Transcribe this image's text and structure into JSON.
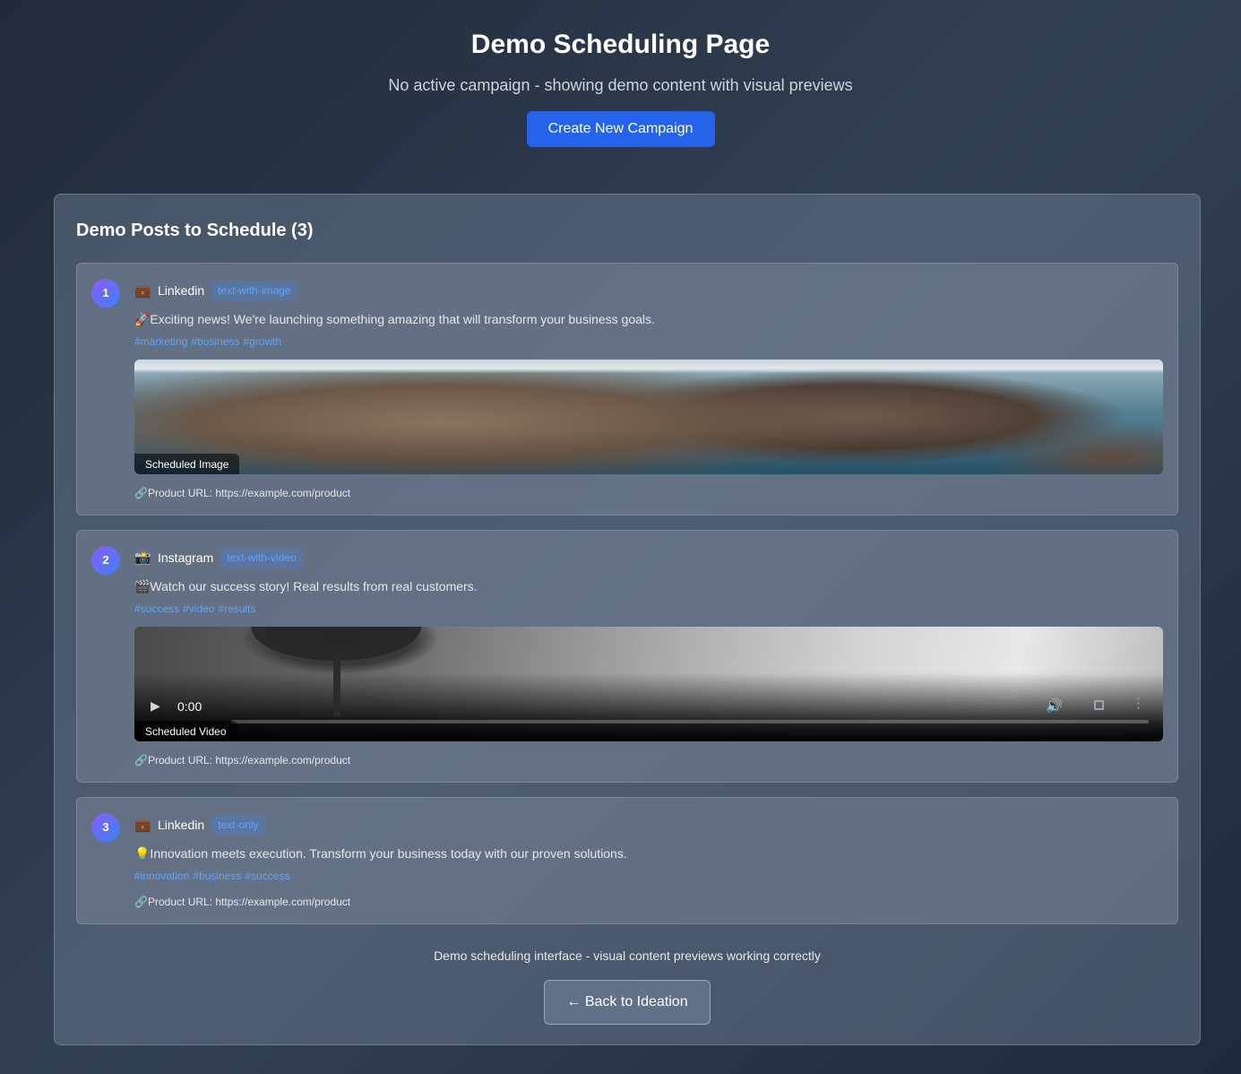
{
  "header": {
    "title": "Demo Scheduling Page",
    "subtitle": "No active campaign - showing demo content with visual previews",
    "create_button": "Create New Campaign"
  },
  "panel": {
    "title": "Demo Posts to Schedule (3)",
    "posts": [
      {
        "number": "1",
        "platform_icon": "💼",
        "platform_icon_name": "briefcase-icon",
        "platform": "Linkedin",
        "type": "text-with-image",
        "text": "🚀Exciting news! We're launching something amazing that will transform your business goals.",
        "hashtags": [
          "#marketing",
          "#business",
          "#growth"
        ],
        "media_label": "Scheduled Image",
        "product_url": "Product URL: https://example.com/product"
      },
      {
        "number": "2",
        "platform_icon": "📸",
        "platform_icon_name": "camera-icon",
        "platform": "Instagram",
        "type": "text-with-video",
        "text": "🎬Watch our success story! Real results from real customers.",
        "hashtags": [
          "#success",
          "#video",
          "#results"
        ],
        "media_label": "Scheduled Video",
        "video_time": "0:00",
        "product_url": "Product URL: https://example.com/product"
      },
      {
        "number": "3",
        "platform_icon": "💼",
        "platform_icon_name": "briefcase-icon",
        "platform": "Linkedin",
        "type": "text-only",
        "text": "💡Innovation meets execution. Transform your business today with our proven solutions.",
        "hashtags": [
          "#innovation",
          "#business",
          "#success"
        ],
        "product_url": "Product URL: https://example.com/product"
      }
    ]
  },
  "footer": {
    "note": "Demo scheduling interface - visual content previews working correctly",
    "back_button": "← Back to Ideation"
  },
  "icons": {
    "link": "🔗",
    "play": "▶",
    "volume": "🔊",
    "more": "⋮"
  },
  "colors": {
    "accent": "#2563eb",
    "hashtag": "#60a5fa",
    "badge_text": "#60a5fa"
  }
}
